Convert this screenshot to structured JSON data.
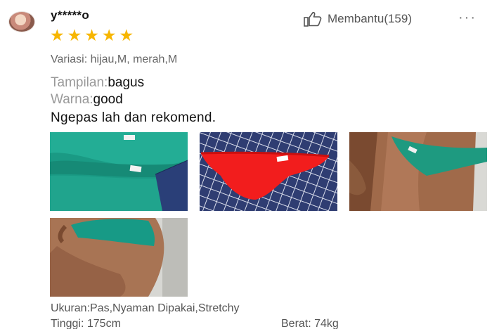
{
  "review": {
    "username": "y*****o",
    "rating": 5,
    "stars": [
      "★",
      "★",
      "★",
      "★",
      "★"
    ],
    "helpful_label": "Membantu(159)",
    "more_glyph": "···",
    "variation": "Variasi: hijau,M, merah,M",
    "attributes": [
      {
        "key": "Tampilan:",
        "value": "bagus"
      },
      {
        "key": "Warna:",
        "value": "good"
      }
    ],
    "comment": "Ngepas lah dan rekomend.",
    "photos": [
      {
        "name": "green-briefs-photo"
      },
      {
        "name": "red-briefs-photo"
      },
      {
        "name": "worn-green-briefs-front-photo"
      },
      {
        "name": "worn-green-briefs-side-photo"
      }
    ],
    "size_line": "Ukuran:Pas,Nyaman Dipakai,Stretchy",
    "height": "Tinggi: 175cm",
    "weight": "Berat: 74kg"
  },
  "colors": {
    "star": "#f7b600",
    "muted_text": "#999999",
    "text": "#111111"
  },
  "icons": {
    "helpful": "thumbs-up-icon",
    "more": "more-icon",
    "avatar": "avatar"
  }
}
